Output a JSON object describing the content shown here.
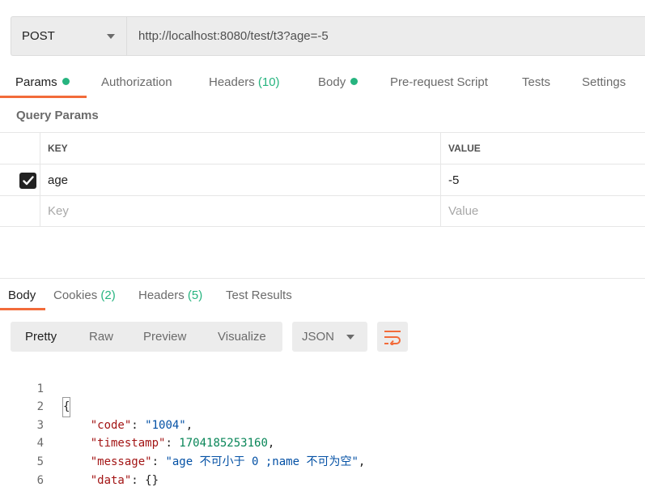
{
  "request": {
    "method": "POST",
    "url": "http://localhost:8080/test/t3?age=-5"
  },
  "request_tabs": [
    {
      "label": "Params",
      "dot": true
    },
    {
      "label": "Authorization"
    },
    {
      "label": "Headers",
      "count": "(10)"
    },
    {
      "label": "Body",
      "dot": true
    },
    {
      "label": "Pre-request Script"
    },
    {
      "label": "Tests"
    },
    {
      "label": "Settings"
    }
  ],
  "query_params": {
    "title": "Query Params",
    "headers": {
      "key": "KEY",
      "value": "VALUE"
    },
    "rows": [
      {
        "checked": true,
        "key": "age",
        "value": "-5"
      }
    ],
    "placeholder": {
      "key": "Key",
      "value": "Value"
    }
  },
  "response_tabs": [
    {
      "label": "Body"
    },
    {
      "label": "Cookies",
      "count": "(2)"
    },
    {
      "label": "Headers",
      "count": "(5)"
    },
    {
      "label": "Test Results"
    }
  ],
  "format": {
    "modes": [
      "Pretty",
      "Raw",
      "Preview",
      "Visualize"
    ],
    "active": "Pretty",
    "language": "JSON"
  },
  "code": {
    "line_numbers": [
      "1",
      "2",
      "3",
      "4",
      "5",
      "6"
    ],
    "open": "{",
    "close": "}",
    "fields": [
      {
        "key": "\"code\"",
        "value": "\"1004\"",
        "type": "string",
        "comma": true
      },
      {
        "key": "\"timestamp\"",
        "value": "1704185253160",
        "type": "number",
        "comma": true
      },
      {
        "key": "\"message\"",
        "value": "\"age 不可小于 0 ;name 不可为空\"",
        "type": "string",
        "comma": true
      },
      {
        "key": "\"data\"",
        "value": "{}",
        "type": "plain",
        "comma": false
      }
    ]
  },
  "colors": {
    "accent": "#f26b3a",
    "success": "#26b47f",
    "json_key": "#a31515",
    "json_string": "#0451a5",
    "json_number": "#098658"
  }
}
